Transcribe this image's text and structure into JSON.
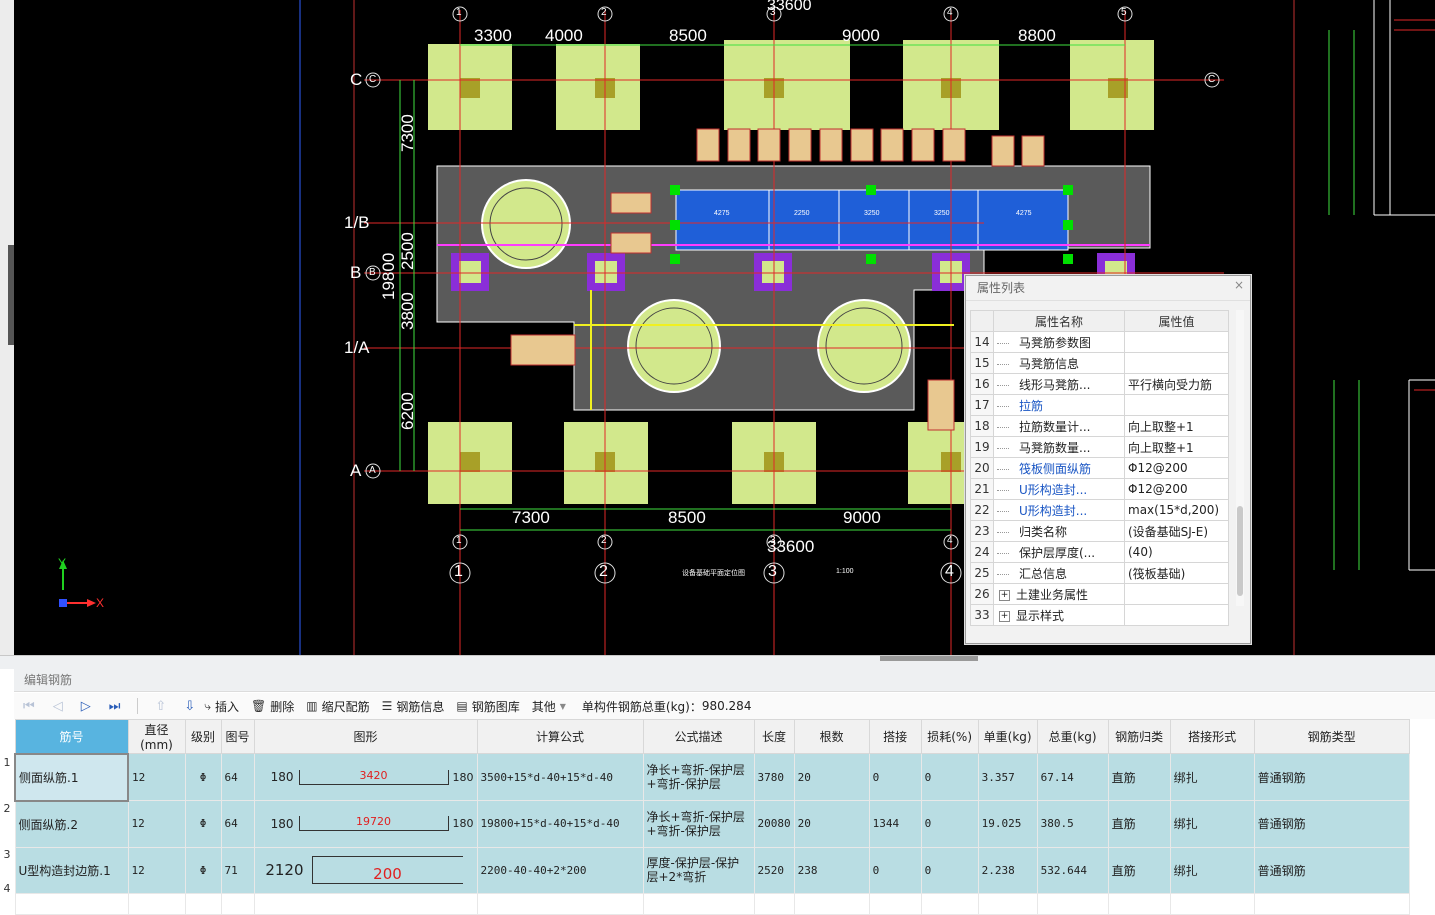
{
  "drawing": {
    "dims_top": [
      "3300",
      "4000",
      "8500",
      "9000",
      "8800"
    ],
    "dim_total_top": "33600",
    "dims_bottom": [
      "7300",
      "8500",
      "9000"
    ],
    "dim_total_bottom": "33600",
    "axis_numbers": [
      "1",
      "2",
      "3",
      "4",
      "5"
    ],
    "row_labels": [
      "C",
      "1/B",
      "B",
      "1/A",
      "A"
    ],
    "row_label_circles": [
      "C",
      "B",
      "A"
    ],
    "vdims_left": [
      "7300",
      "2500",
      "3800",
      "6200"
    ],
    "vdim_total_left": "19800",
    "drawing_title": "设备基础平面定位图",
    "drawing_scale": "1:100",
    "pit_labels": [
      "4275",
      "2250",
      "3250",
      "3250",
      "4275"
    ],
    "axis_x_label": "X",
    "axis_y_label": "Y"
  },
  "properties": {
    "title": "属性列表",
    "close_label": "×",
    "header_name": "属性名称",
    "header_value": "属性值",
    "rows": [
      {
        "num": "14",
        "name": "马凳筋参数图",
        "value": "",
        "blue": false
      },
      {
        "num": "15",
        "name": "马凳筋信息",
        "value": "",
        "blue": false
      },
      {
        "num": "16",
        "name": "线形马凳筋...",
        "value": "平行横向受力筋",
        "blue": false
      },
      {
        "num": "17",
        "name": "拉筋",
        "value": "",
        "blue": true
      },
      {
        "num": "18",
        "name": "拉筋数量计...",
        "value": "向上取整+1",
        "blue": false
      },
      {
        "num": "19",
        "name": "马凳筋数量...",
        "value": "向上取整+1",
        "blue": false
      },
      {
        "num": "20",
        "name": "筏板侧面纵筋",
        "value": "Φ12@200",
        "blue": true
      },
      {
        "num": "21",
        "name": "U形构造封...",
        "value": "Φ12@200",
        "blue": true
      },
      {
        "num": "22",
        "name": "U形构造封...",
        "value": "max(15*d,200)",
        "blue": true
      },
      {
        "num": "23",
        "name": "归类名称",
        "value": "(设备基础SJ-E)",
        "blue": false
      },
      {
        "num": "24",
        "name": "保护层厚度(...",
        "value": "(40)",
        "blue": false
      },
      {
        "num": "25",
        "name": "汇总信息",
        "value": "(筏板基础)",
        "blue": false
      }
    ],
    "group_rows": [
      {
        "num": "26",
        "name": "土建业务属性"
      },
      {
        "num": "33",
        "name": "显示样式"
      }
    ]
  },
  "editor": {
    "title": "编辑钢筋",
    "toolbar": {
      "insert": "插入",
      "delete": "删除",
      "scale": "缩尺配筋",
      "info": "钢筋信息",
      "library": "钢筋图库",
      "other": "其他",
      "total_weight_label": "单构件钢筋总重(kg)：",
      "total_weight": "980.284"
    },
    "columns": [
      "筋号",
      "直径(mm)",
      "级别",
      "图号",
      "图形",
      "计算公式",
      "公式描述",
      "长度",
      "根数",
      "搭接",
      "损耗(%)",
      "单重(kg)",
      "总重(kg)",
      "钢筋归类",
      "搭接形式",
      "钢筋类型"
    ],
    "rows": [
      {
        "idx": "1",
        "name": "侧面纵筋.1",
        "dia": "12",
        "grade": "Φ",
        "fig": "64",
        "end_l": "180",
        "mid": "3420",
        "end_r": "180",
        "formula": "3500+15*d-40+15*d-40",
        "desc": "净长+弯折-保护层+弯折-保护层",
        "len": "3780",
        "count": "20",
        "lap": "0",
        "loss": "0",
        "unit": "3.357",
        "total": "67.14",
        "cat": "直筋",
        "lapform": "绑扎",
        "type": "普通钢筋"
      },
      {
        "idx": "2",
        "name": "侧面纵筋.2",
        "dia": "12",
        "grade": "Φ",
        "fig": "64",
        "end_l": "180",
        "mid": "19720",
        "end_r": "180",
        "formula": "19800+15*d-40+15*d-40",
        "desc": "净长+弯折-保护层+弯折-保护层",
        "len": "20080",
        "count": "20",
        "lap": "1344",
        "loss": "0",
        "unit": "19.025",
        "total": "380.5",
        "cat": "直筋",
        "lapform": "绑扎",
        "type": "普通钢筋"
      },
      {
        "idx": "3",
        "name": "U型构造封边筋.1",
        "dia": "12",
        "grade": "Φ",
        "fig": "71",
        "end_l": "2120",
        "mid": "200",
        "end_r": "",
        "formula": "2200-40-40+2*200",
        "desc": "厚度-保护层-保护层+2*弯折",
        "len": "2520",
        "count": "238",
        "lap": "0",
        "loss": "0",
        "unit": "2.238",
        "total": "532.644",
        "cat": "直筋",
        "lapform": "绑扎",
        "type": "普通钢筋"
      }
    ],
    "empty_row_idx": "4"
  }
}
